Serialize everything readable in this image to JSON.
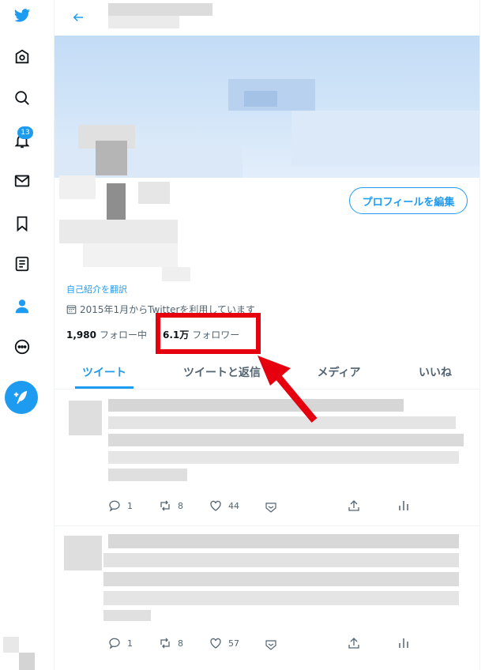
{
  "sidebar": {
    "notification_count": "13",
    "items": [
      {
        "icon": "bird-logo-icon"
      },
      {
        "icon": "home-icon"
      },
      {
        "icon": "search-icon"
      },
      {
        "icon": "bell-icon"
      },
      {
        "icon": "envelope-icon"
      },
      {
        "icon": "bookmark-icon"
      },
      {
        "icon": "list-icon"
      },
      {
        "icon": "profile-icon"
      },
      {
        "icon": "more-icon"
      },
      {
        "icon": "compose-icon"
      }
    ]
  },
  "profile": {
    "edit_button": "プロフィールを編集",
    "translate_link": "自己紹介を翻訳",
    "joined": "2015年1月からTwitterを利用しています",
    "following_count": "1,980",
    "following_label": "フォロー中",
    "followers_count": "6.1万",
    "followers_label": "フォロワー"
  },
  "tabs": [
    "ツイート",
    "ツイートと返信",
    "メディア",
    "いいね"
  ],
  "tweets": [
    {
      "replies": "1",
      "retweets": "8",
      "likes": "44"
    },
    {
      "replies": "1",
      "retweets": "8",
      "likes": "57"
    }
  ],
  "colors": {
    "accent": "#1d9bf0",
    "highlight": "#e6000f",
    "text_secondary": "#536471"
  }
}
